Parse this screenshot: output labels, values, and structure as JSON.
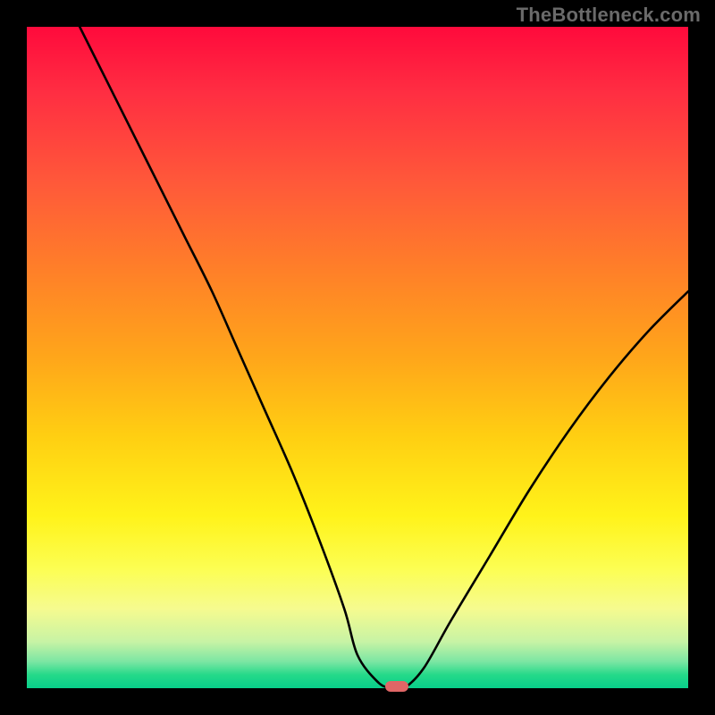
{
  "watermark": "TheBottleneck.com",
  "colors": {
    "frame_bg": "#000000",
    "marker": "#e06666",
    "curve": "#000000",
    "watermark": "#6a6a6a"
  },
  "chart_data": {
    "type": "line",
    "title": "",
    "xlabel": "",
    "ylabel": "",
    "xlim": [
      0,
      100
    ],
    "ylim": [
      0,
      100
    ],
    "grid": false,
    "legend": false,
    "series": [
      {
        "name": "bottleneck-curve",
        "x": [
          8,
          12,
          16,
          20,
          24,
          28,
          32,
          36,
          40,
          44,
          48,
          50,
          53,
          55,
          57,
          60,
          64,
          70,
          76,
          82,
          88,
          94,
          100
        ],
        "y": [
          100,
          92,
          84,
          76,
          68,
          60,
          51,
          42,
          33,
          23,
          12,
          5,
          1,
          0,
          0,
          3,
          10,
          20,
          30,
          39,
          47,
          54,
          60
        ]
      }
    ],
    "marker": {
      "x": 56,
      "y": 0
    },
    "gradient_stops": [
      {
        "pos": 0,
        "color": "#ff0a3c"
      },
      {
        "pos": 10,
        "color": "#ff2e42"
      },
      {
        "pos": 24,
        "color": "#ff5a39"
      },
      {
        "pos": 38,
        "color": "#ff8327"
      },
      {
        "pos": 50,
        "color": "#ffa61a"
      },
      {
        "pos": 62,
        "color": "#ffcf12"
      },
      {
        "pos": 74,
        "color": "#fff31a"
      },
      {
        "pos": 82,
        "color": "#fcfe53"
      },
      {
        "pos": 88,
        "color": "#f6fb8f"
      },
      {
        "pos": 93,
        "color": "#c7f3a5"
      },
      {
        "pos": 96,
        "color": "#7be6a3"
      },
      {
        "pos": 98,
        "color": "#24d989"
      },
      {
        "pos": 100,
        "color": "#08cf8a"
      }
    ]
  }
}
